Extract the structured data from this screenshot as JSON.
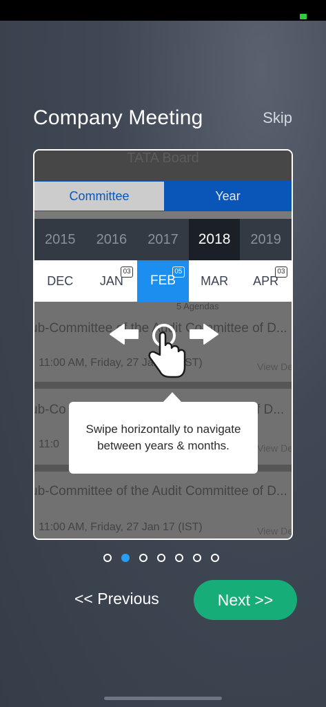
{
  "header": {
    "title": "Company Meeting",
    "skip_label": "Skip"
  },
  "card": {
    "ghost_title": "TATA Board",
    "segments": [
      "Committee",
      "Year"
    ],
    "years": [
      "2015",
      "2016",
      "2017",
      "2018",
      "2019"
    ],
    "active_year": "2018",
    "months": [
      {
        "label": "DEC",
        "badge": ""
      },
      {
        "label": "JAN",
        "badge": "03"
      },
      {
        "label": "FEB",
        "badge": "05"
      },
      {
        "label": "MAR",
        "badge": ""
      },
      {
        "label": "APR",
        "badge": "03"
      }
    ],
    "active_month": "FEB",
    "list": {
      "agenda_label": "5 Agendas",
      "row1_title": "ub-Committee of the Audit Committee of D...",
      "row1_time": "11:00 AM, Friday, 27 Jan 17 (IST)",
      "row1_view": "View De",
      "row2_title": "ub-Co",
      "row2_title_end": "f D...",
      "row2_time": "11:0",
      "row2_view": "View De",
      "row3_title": "ub-Committee of the Audit Committee of D...",
      "row3_time": "11:00 AM, Friday, 27 Jan 17 (IST)",
      "row3_view": "View De"
    },
    "tooltip": {
      "line1": "Swipe horizontally to navigate",
      "line2": "between years & months."
    }
  },
  "pager": {
    "count": 7,
    "active_index": 1
  },
  "footer": {
    "previous_label": "<< Previous",
    "next_label": "Next >>"
  },
  "colors": {
    "accent_blue": "#0a56b8",
    "active_month": "#1b8ef0",
    "next_button": "#17ad79",
    "active_dot": "#2a9df4"
  },
  "icons": [
    "swipe-hand-icon",
    "arrow-left-icon",
    "arrow-right-icon"
  ]
}
